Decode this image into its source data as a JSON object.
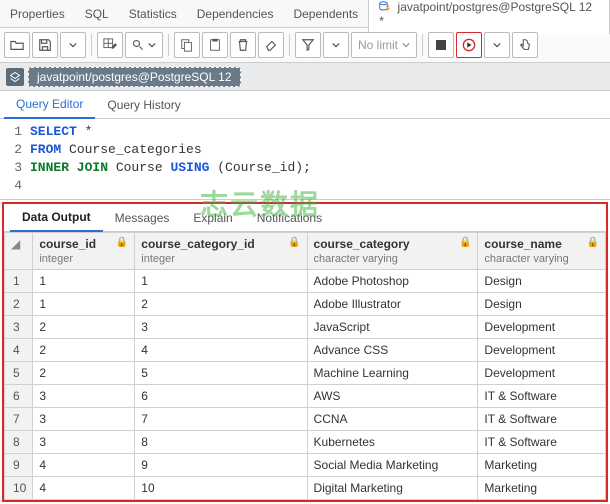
{
  "toptabs": {
    "items": [
      "Properties",
      "SQL",
      "Statistics",
      "Dependencies",
      "Dependents"
    ],
    "active": "javatpoint/postgres@PostgreSQL 12 *"
  },
  "toolbar": {
    "nolimit": "No limit"
  },
  "breadcrumb": {
    "path": "javatpoint/postgres@PostgreSQL 12"
  },
  "editor_tabs": {
    "a": "Query Editor",
    "b": "Query History"
  },
  "sql": [
    "SELECT *",
    "FROM Course_categories",
    "INNER JOIN Course USING (Course_id);",
    ""
  ],
  "watermark": "志云数据",
  "result_tabs": {
    "a": "Data Output",
    "b": "Messages",
    "c": "Explain",
    "d": "Notifications"
  },
  "columns": [
    {
      "name": "course_id",
      "type": "integer"
    },
    {
      "name": "course_category_id",
      "type": "integer"
    },
    {
      "name": "course_category",
      "type": "character varying"
    },
    {
      "name": "course_name",
      "type": "character varying"
    }
  ],
  "rows": [
    {
      "n": 1,
      "course_id": 1,
      "course_category_id": 1,
      "course_category": "Adobe Photoshop",
      "course_name": "Design"
    },
    {
      "n": 2,
      "course_id": 1,
      "course_category_id": 2,
      "course_category": "Adobe Illustrator",
      "course_name": "Design"
    },
    {
      "n": 3,
      "course_id": 2,
      "course_category_id": 3,
      "course_category": "JavaScript",
      "course_name": "Development"
    },
    {
      "n": 4,
      "course_id": 2,
      "course_category_id": 4,
      "course_category": "Advance CSS",
      "course_name": "Development"
    },
    {
      "n": 5,
      "course_id": 2,
      "course_category_id": 5,
      "course_category": "Machine Learning",
      "course_name": "Development"
    },
    {
      "n": 6,
      "course_id": 3,
      "course_category_id": 6,
      "course_category": "AWS",
      "course_name": "IT & Software"
    },
    {
      "n": 7,
      "course_id": 3,
      "course_category_id": 7,
      "course_category": "CCNA",
      "course_name": "IT & Software"
    },
    {
      "n": 8,
      "course_id": 3,
      "course_category_id": 8,
      "course_category": "Kubernetes",
      "course_name": "IT & Software"
    },
    {
      "n": 9,
      "course_id": 4,
      "course_category_id": 9,
      "course_category": "Social Media Marketing",
      "course_name": "Marketing"
    },
    {
      "n": 10,
      "course_id": 4,
      "course_category_id": 10,
      "course_category": "Digital Marketing",
      "course_name": "Marketing"
    }
  ]
}
